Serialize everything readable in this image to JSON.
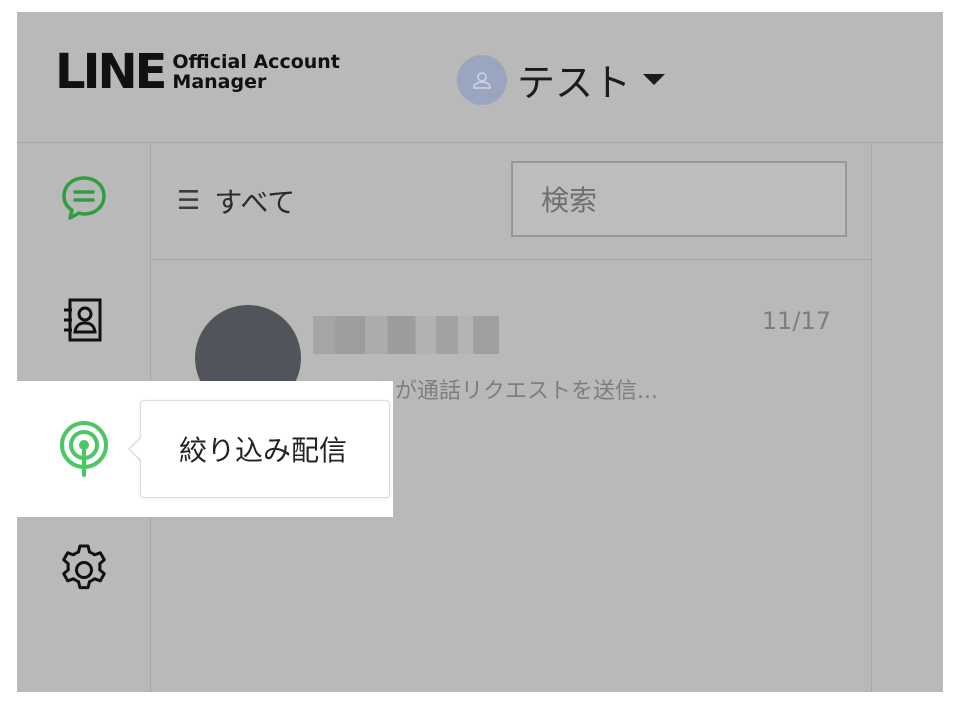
{
  "header": {
    "logo_main": "LINE",
    "logo_sub_1": "Official Account",
    "logo_sub_2": "Manager",
    "account_name": "テスト",
    "account_icon": "person-icon",
    "caret_icon": "caret-down-icon"
  },
  "sidebar": {
    "items": [
      {
        "name": "chats",
        "icon": "chat-bubble-icon",
        "color": "#2e9e3f"
      },
      {
        "name": "contacts",
        "icon": "contact-book-icon",
        "color": "#111111"
      },
      {
        "name": "narrowcast",
        "icon": "broadcast-icon",
        "color": "#4cc764"
      },
      {
        "name": "settings",
        "icon": "gear-icon",
        "color": "#111111"
      }
    ],
    "tooltip": "絞り込み配信"
  },
  "toolbar": {
    "filter_label": "すべて",
    "filter_icon": "menu-icon",
    "search_placeholder": "検索"
  },
  "chats": [
    {
      "preview": "テストが通話リクエストを送信...",
      "date": "11/17"
    }
  ]
}
